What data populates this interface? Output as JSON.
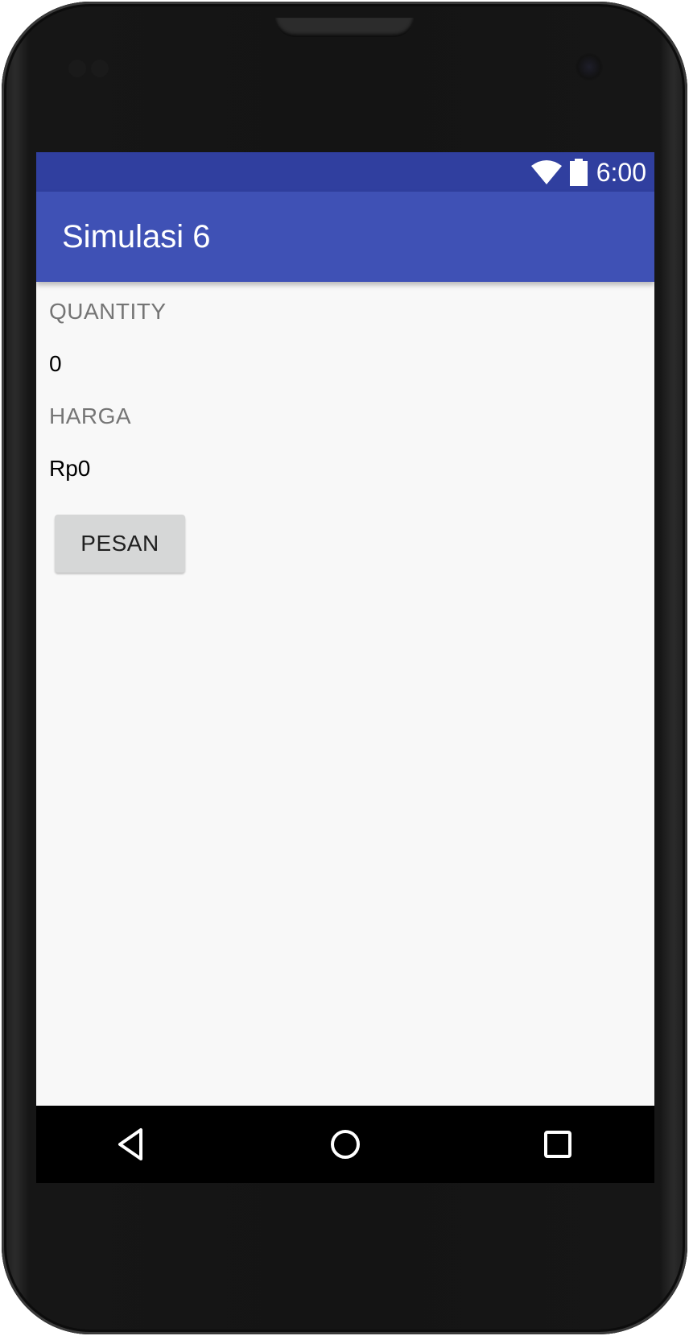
{
  "status_bar": {
    "time": "6:00",
    "wifi_icon": "wifi-icon",
    "battery_icon": "battery-icon",
    "color": "#303f9f"
  },
  "app_bar": {
    "title": "Simulasi 6",
    "color": "#3f51b5"
  },
  "main": {
    "quantity_label": "QUANTITY",
    "quantity_value": "0",
    "price_label": "HARGA",
    "price_value": "Rp0",
    "order_button_label": "PESAN"
  },
  "nav_bar": {
    "back_icon": "back-triangle-icon",
    "home_icon": "home-circle-icon",
    "recents_icon": "recents-square-icon"
  }
}
